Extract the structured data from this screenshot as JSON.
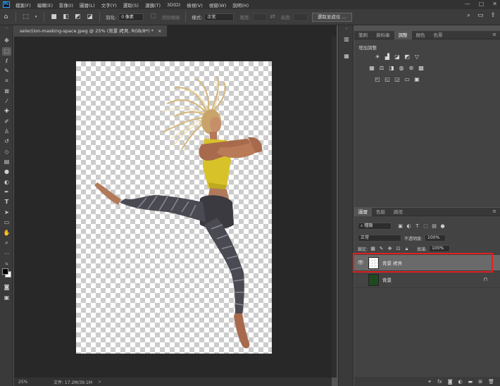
{
  "menu": {
    "logo": "Ps",
    "items": [
      "檔案(F)",
      "編輯(E)",
      "影像(I)",
      "圖層(L)",
      "文字(Y)",
      "選取(S)",
      "濾鏡(T)",
      "3D(D)",
      "檢視(V)",
      "視窗(W)",
      "說明(H)"
    ],
    "window_controls": [
      "—",
      "□",
      "✕"
    ]
  },
  "options_bar": {
    "feather_label": "羽化:",
    "feather_value": "0 像素",
    "antialias_label": "消除鋸齒",
    "style_label": "樣式:",
    "style_value": "正常",
    "width_label": "寬度:",
    "height_label": "高度:",
    "select_subject": "選取並遮住 ..."
  },
  "document": {
    "tab_title": "selection-masking-space.jpeg @ 25% (背景 拷貝, RGB/8*) *",
    "tab_close": "×"
  },
  "status": {
    "zoom": "25%",
    "doc_info": "文件: 17.2M/39.1M",
    "arrow": ">"
  },
  "adjustments": {
    "tabs": [
      "筆刷",
      "資料庫",
      "調整",
      "顏色",
      "色票"
    ],
    "active_tab": 2,
    "title": "增加調整",
    "menu": "≡"
  },
  "layers": {
    "tabs": [
      "圖層",
      "色版",
      "路徑"
    ],
    "kind_label": "種類",
    "blend_mode": "正常",
    "opacity_label": "不透明度:",
    "opacity_value": "100%",
    "lock_label": "鎖定:",
    "fill_label": "填滿:",
    "fill_value": "100%",
    "items": [
      {
        "name": "背景 拷貝",
        "visible": true,
        "selected": true
      },
      {
        "name": "背景",
        "visible": false,
        "selected": false
      }
    ],
    "menu": "≡"
  },
  "colors": {
    "highlight": "#e02020",
    "selected_layer": "#6a6a6a",
    "accent": "#31a8ff"
  }
}
